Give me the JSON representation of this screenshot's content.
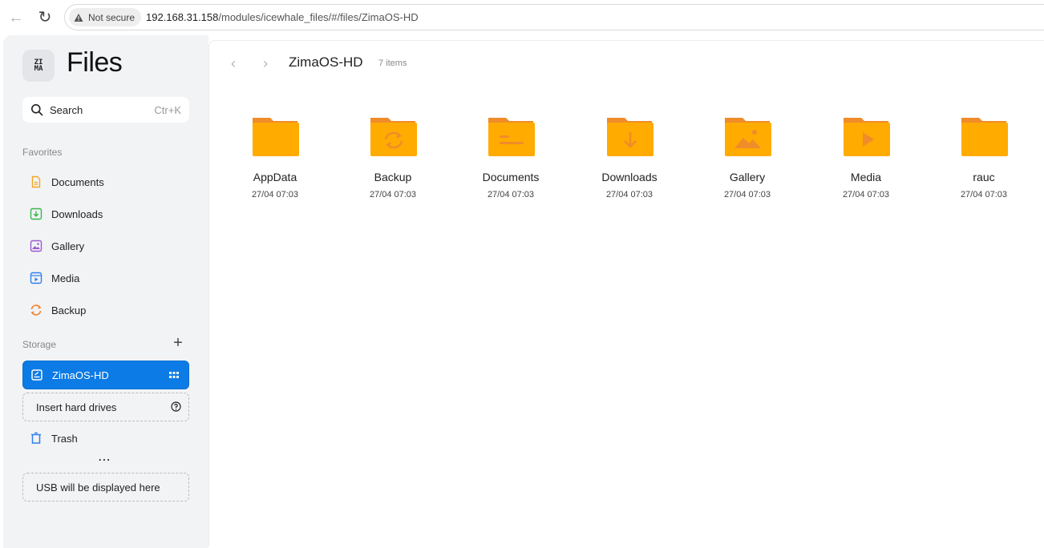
{
  "browser": {
    "security_label": "Not secure",
    "url_host": "192.168.31.158",
    "url_path": "/modules/icewhale_files/#/files/ZimaOS-HD"
  },
  "sidebar": {
    "logo_text_top": "ZI",
    "logo_text_bottom": "MA",
    "app_title": "Files",
    "search": {
      "label": "Search",
      "shortcut": "Ctr+K"
    },
    "favorites_label": "Favorites",
    "favorites": [
      {
        "label": "Documents",
        "icon": "document-icon",
        "color": "#f5a623"
      },
      {
        "label": "Downloads",
        "icon": "download-icon",
        "color": "#3ab54a"
      },
      {
        "label": "Gallery",
        "icon": "gallery-icon",
        "color": "#9b59d0"
      },
      {
        "label": "Media",
        "icon": "media-icon",
        "color": "#2f80ed"
      },
      {
        "label": "Backup",
        "icon": "backup-icon",
        "color": "#f2842e"
      }
    ],
    "storage_label": "Storage",
    "storage_active": {
      "label": "ZimaOS-HD"
    },
    "insert_drives": {
      "label": "Insert hard drives"
    },
    "trash": {
      "label": "Trash"
    },
    "usb_placeholder": {
      "label": "USB will be displayed here"
    }
  },
  "main": {
    "title": "ZimaOS-HD",
    "item_count": "7 items",
    "folders": [
      {
        "name": "AppData",
        "date": "27/04 07:03",
        "emblem": "none"
      },
      {
        "name": "Backup",
        "date": "27/04 07:03",
        "emblem": "sync"
      },
      {
        "name": "Documents",
        "date": "27/04 07:03",
        "emblem": "lines"
      },
      {
        "name": "Downloads",
        "date": "27/04 07:03",
        "emblem": "arrow-down"
      },
      {
        "name": "Gallery",
        "date": "27/04 07:03",
        "emblem": "mountain"
      },
      {
        "name": "Media",
        "date": "27/04 07:03",
        "emblem": "play"
      },
      {
        "name": "rauc",
        "date": "27/04 07:03",
        "emblem": "none"
      }
    ]
  },
  "colors": {
    "accent": "#0c7be5",
    "folder_body": "#ffab00",
    "folder_tab": "#f08c2a"
  }
}
